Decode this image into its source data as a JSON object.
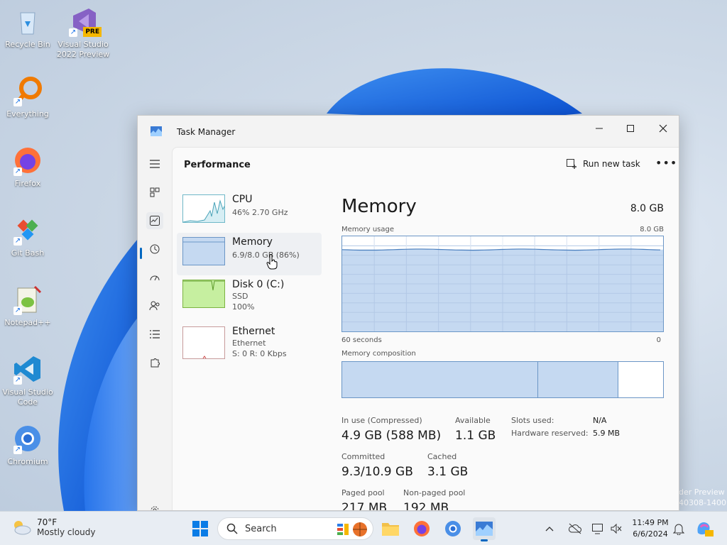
{
  "desktop": {
    "icons": [
      {
        "label": "Recycle Bin",
        "name": "recycle-bin"
      },
      {
        "label": "Visual Studio 2022 Preview",
        "name": "visual-studio-preview",
        "badge": "PRE"
      },
      {
        "label": "Everything",
        "name": "everything"
      },
      {
        "label": "Firefox",
        "name": "firefox"
      },
      {
        "label": "Git Bash",
        "name": "git-bash"
      },
      {
        "label": "Notepad++",
        "name": "notepad-plus-plus"
      },
      {
        "label": "Visual Studio Code",
        "name": "vscode"
      },
      {
        "label": "Chromium",
        "name": "chromium"
      }
    ],
    "watermark_line1": "der Preview",
    "watermark_line2": "40308-1400"
  },
  "window": {
    "title": "Task Manager",
    "page_title": "Performance",
    "run_new_task": "Run new task",
    "more": "•••",
    "list": [
      {
        "name": "CPU",
        "sub1": "46% 2.70 GHz",
        "sub2": ""
      },
      {
        "name": "Memory",
        "sub1": "6.9/8.0 GB (86%)",
        "sub2": ""
      },
      {
        "name": "Disk 0 (C:)",
        "sub1": "SSD",
        "sub2": "100%"
      },
      {
        "name": "Ethernet",
        "sub1": "Ethernet",
        "sub2": "S: 0 R: 0 Kbps"
      }
    ],
    "detail": {
      "title": "Memory",
      "total": "8.0 GB",
      "usage_label": "Memory usage",
      "usage_max": "8.0 GB",
      "axis_left": "60 seconds",
      "axis_right": "0",
      "composition_label": "Memory composition",
      "composition": {
        "in_use_fraction": 0.61,
        "standby_fraction": 0.25,
        "free_fraction": 0.14
      },
      "usage_fraction": 0.86,
      "stats": {
        "in_use_label": "In use (Compressed)",
        "in_use": "4.9 GB (588 MB)",
        "available_label": "Available",
        "available": "1.1 GB",
        "committed_label": "Committed",
        "committed": "9.3/10.9 GB",
        "cached_label": "Cached",
        "cached": "3.1 GB",
        "paged_label": "Paged pool",
        "paged": "217 MB",
        "nonpaged_label": "Non-paged pool",
        "nonpaged": "192 MB",
        "slots_label": "Slots used:",
        "slots": "N/A",
        "hw_label": "Hardware reserved:",
        "hw": "5.9 MB"
      }
    }
  },
  "taskbar": {
    "weather_temp": "70°F",
    "weather_desc": "Mostly cloudy",
    "search_placeholder": "Search",
    "time": "11:49 PM",
    "date": "6/6/2024"
  },
  "colors": {
    "accent": "#0067c0",
    "graph_fill": "#c5d9f1",
    "graph_line": "#6b96c6",
    "disk_fill": "#c6efa0"
  }
}
